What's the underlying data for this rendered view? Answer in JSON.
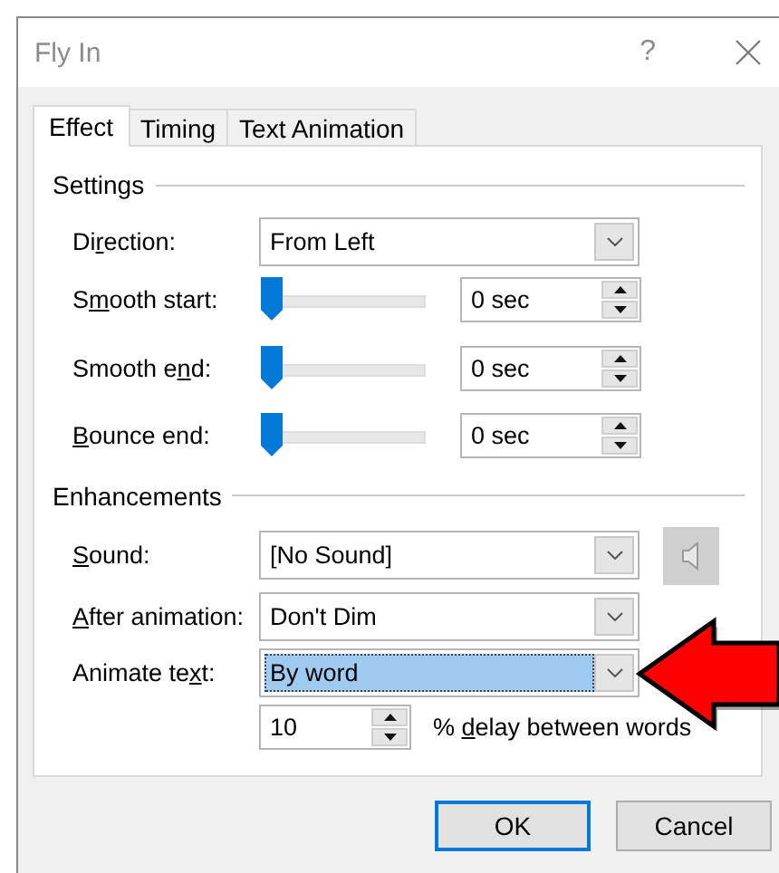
{
  "window": {
    "title": "Fly In",
    "help": "?"
  },
  "tabs": [
    {
      "label": "Effect",
      "selected": true
    },
    {
      "label": "Timing",
      "selected": false
    },
    {
      "label": "Text Animation",
      "selected": false
    }
  ],
  "settings": {
    "title": "Settings",
    "rows": [
      {
        "kind": "combo",
        "label": {
          "before": "Di",
          "key": "r",
          "after": "ection:"
        },
        "value": "From Left"
      },
      {
        "kind": "slider",
        "label": {
          "before": "S",
          "key": "m",
          "after": "ooth start:"
        },
        "level": 0,
        "value": "0 sec"
      },
      {
        "kind": "slider",
        "label": {
          "before": "Smooth e",
          "key": "n",
          "after": "d:"
        },
        "level": 0,
        "value": "0 sec"
      },
      {
        "kind": "slider",
        "label": {
          "key": "B",
          "after": "ounce end:"
        },
        "level": 0,
        "value": "0 sec"
      }
    ]
  },
  "enhancements": {
    "title": "Enhancements",
    "rows": [
      {
        "label": {
          "key": "S",
          "after": "ound:"
        },
        "value": "[No Sound]",
        "focused": false
      },
      {
        "label": {
          "key": "A",
          "after": "fter animation:"
        },
        "value": "Don't Dim",
        "focused": false
      },
      {
        "label": {
          "before": "Animate te",
          "key": "x",
          "after": "t:"
        },
        "value": "By word",
        "focused": true
      }
    ],
    "speaker_button": {
      "disabled": true
    },
    "delay": {
      "value": "10",
      "label": {
        "before": "% ",
        "key": "d",
        "after": "elay between words"
      }
    }
  },
  "buttons": [
    {
      "label": "OK",
      "default": true
    },
    {
      "label": "Cancel",
      "default": false
    }
  ]
}
